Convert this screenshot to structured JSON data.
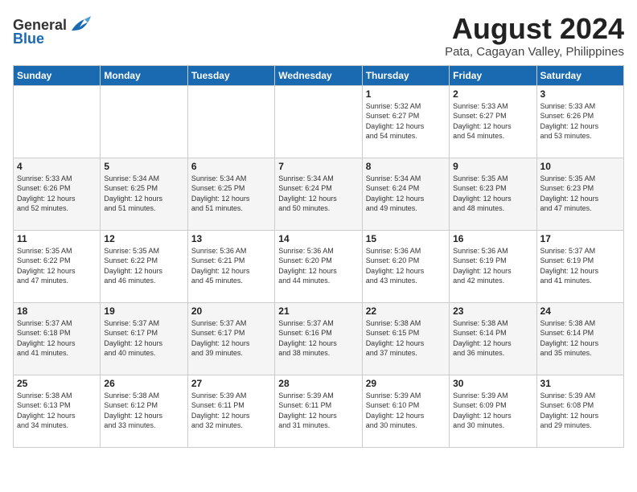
{
  "logo": {
    "general": "General",
    "blue": "Blue"
  },
  "title": {
    "month_year": "August 2024",
    "location": "Pata, Cagayan Valley, Philippines"
  },
  "days_of_week": [
    "Sunday",
    "Monday",
    "Tuesday",
    "Wednesday",
    "Thursday",
    "Friday",
    "Saturday"
  ],
  "weeks": [
    [
      {
        "day": "",
        "info": ""
      },
      {
        "day": "",
        "info": ""
      },
      {
        "day": "",
        "info": ""
      },
      {
        "day": "",
        "info": ""
      },
      {
        "day": "1",
        "info": "Sunrise: 5:32 AM\nSunset: 6:27 PM\nDaylight: 12 hours\nand 54 minutes."
      },
      {
        "day": "2",
        "info": "Sunrise: 5:33 AM\nSunset: 6:27 PM\nDaylight: 12 hours\nand 54 minutes."
      },
      {
        "day": "3",
        "info": "Sunrise: 5:33 AM\nSunset: 6:26 PM\nDaylight: 12 hours\nand 53 minutes."
      }
    ],
    [
      {
        "day": "4",
        "info": "Sunrise: 5:33 AM\nSunset: 6:26 PM\nDaylight: 12 hours\nand 52 minutes."
      },
      {
        "day": "5",
        "info": "Sunrise: 5:34 AM\nSunset: 6:25 PM\nDaylight: 12 hours\nand 51 minutes."
      },
      {
        "day": "6",
        "info": "Sunrise: 5:34 AM\nSunset: 6:25 PM\nDaylight: 12 hours\nand 51 minutes."
      },
      {
        "day": "7",
        "info": "Sunrise: 5:34 AM\nSunset: 6:24 PM\nDaylight: 12 hours\nand 50 minutes."
      },
      {
        "day": "8",
        "info": "Sunrise: 5:34 AM\nSunset: 6:24 PM\nDaylight: 12 hours\nand 49 minutes."
      },
      {
        "day": "9",
        "info": "Sunrise: 5:35 AM\nSunset: 6:23 PM\nDaylight: 12 hours\nand 48 minutes."
      },
      {
        "day": "10",
        "info": "Sunrise: 5:35 AM\nSunset: 6:23 PM\nDaylight: 12 hours\nand 47 minutes."
      }
    ],
    [
      {
        "day": "11",
        "info": "Sunrise: 5:35 AM\nSunset: 6:22 PM\nDaylight: 12 hours\nand 47 minutes."
      },
      {
        "day": "12",
        "info": "Sunrise: 5:35 AM\nSunset: 6:22 PM\nDaylight: 12 hours\nand 46 minutes."
      },
      {
        "day": "13",
        "info": "Sunrise: 5:36 AM\nSunset: 6:21 PM\nDaylight: 12 hours\nand 45 minutes."
      },
      {
        "day": "14",
        "info": "Sunrise: 5:36 AM\nSunset: 6:20 PM\nDaylight: 12 hours\nand 44 minutes."
      },
      {
        "day": "15",
        "info": "Sunrise: 5:36 AM\nSunset: 6:20 PM\nDaylight: 12 hours\nand 43 minutes."
      },
      {
        "day": "16",
        "info": "Sunrise: 5:36 AM\nSunset: 6:19 PM\nDaylight: 12 hours\nand 42 minutes."
      },
      {
        "day": "17",
        "info": "Sunrise: 5:37 AM\nSunset: 6:19 PM\nDaylight: 12 hours\nand 41 minutes."
      }
    ],
    [
      {
        "day": "18",
        "info": "Sunrise: 5:37 AM\nSunset: 6:18 PM\nDaylight: 12 hours\nand 41 minutes."
      },
      {
        "day": "19",
        "info": "Sunrise: 5:37 AM\nSunset: 6:17 PM\nDaylight: 12 hours\nand 40 minutes."
      },
      {
        "day": "20",
        "info": "Sunrise: 5:37 AM\nSunset: 6:17 PM\nDaylight: 12 hours\nand 39 minutes."
      },
      {
        "day": "21",
        "info": "Sunrise: 5:37 AM\nSunset: 6:16 PM\nDaylight: 12 hours\nand 38 minutes."
      },
      {
        "day": "22",
        "info": "Sunrise: 5:38 AM\nSunset: 6:15 PM\nDaylight: 12 hours\nand 37 minutes."
      },
      {
        "day": "23",
        "info": "Sunrise: 5:38 AM\nSunset: 6:14 PM\nDaylight: 12 hours\nand 36 minutes."
      },
      {
        "day": "24",
        "info": "Sunrise: 5:38 AM\nSunset: 6:14 PM\nDaylight: 12 hours\nand 35 minutes."
      }
    ],
    [
      {
        "day": "25",
        "info": "Sunrise: 5:38 AM\nSunset: 6:13 PM\nDaylight: 12 hours\nand 34 minutes."
      },
      {
        "day": "26",
        "info": "Sunrise: 5:38 AM\nSunset: 6:12 PM\nDaylight: 12 hours\nand 33 minutes."
      },
      {
        "day": "27",
        "info": "Sunrise: 5:39 AM\nSunset: 6:11 PM\nDaylight: 12 hours\nand 32 minutes."
      },
      {
        "day": "28",
        "info": "Sunrise: 5:39 AM\nSunset: 6:11 PM\nDaylight: 12 hours\nand 31 minutes."
      },
      {
        "day": "29",
        "info": "Sunrise: 5:39 AM\nSunset: 6:10 PM\nDaylight: 12 hours\nand 30 minutes."
      },
      {
        "day": "30",
        "info": "Sunrise: 5:39 AM\nSunset: 6:09 PM\nDaylight: 12 hours\nand 30 minutes."
      },
      {
        "day": "31",
        "info": "Sunrise: 5:39 AM\nSunset: 6:08 PM\nDaylight: 12 hours\nand 29 minutes."
      }
    ]
  ]
}
